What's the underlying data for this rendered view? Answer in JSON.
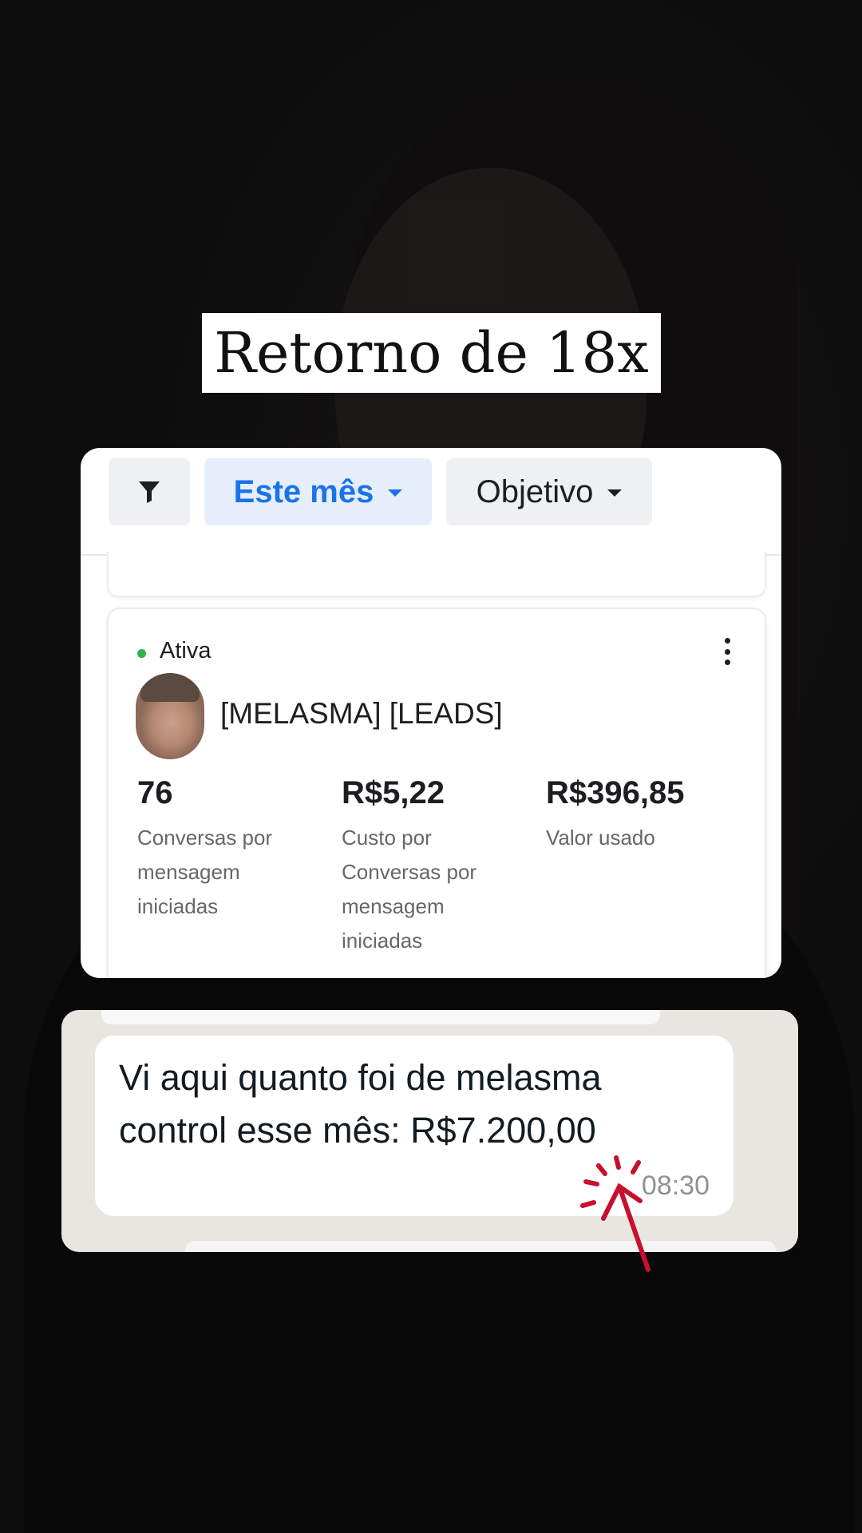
{
  "overlay": {
    "title": "Retorno de 18x"
  },
  "ads_manager": {
    "filters": {
      "date_range": "Este mês",
      "objective": "Objetivo"
    },
    "campaign": {
      "status": "Ativa",
      "name": "[MELASMA] [LEADS]",
      "metrics": [
        {
          "value": "76",
          "label": "Conversas por mensagem iniciadas"
        },
        {
          "value": "R$5,22",
          "label": "Custo por Conversas por mensagem iniciadas"
        },
        {
          "value": "R$396,85",
          "label": "Valor usado"
        }
      ]
    }
  },
  "chat": {
    "message": "Vi aqui quanto foi de melasma control esse mês: R$7.200,00",
    "time": "08:30"
  },
  "colors": {
    "accent_blue": "#1a73e8",
    "status_green": "#34b04a",
    "annotation_red": "#c8102e"
  },
  "icons": [
    "filter-icon",
    "caret-down-icon",
    "more-vertical-icon",
    "arrow-annotation-icon"
  ]
}
